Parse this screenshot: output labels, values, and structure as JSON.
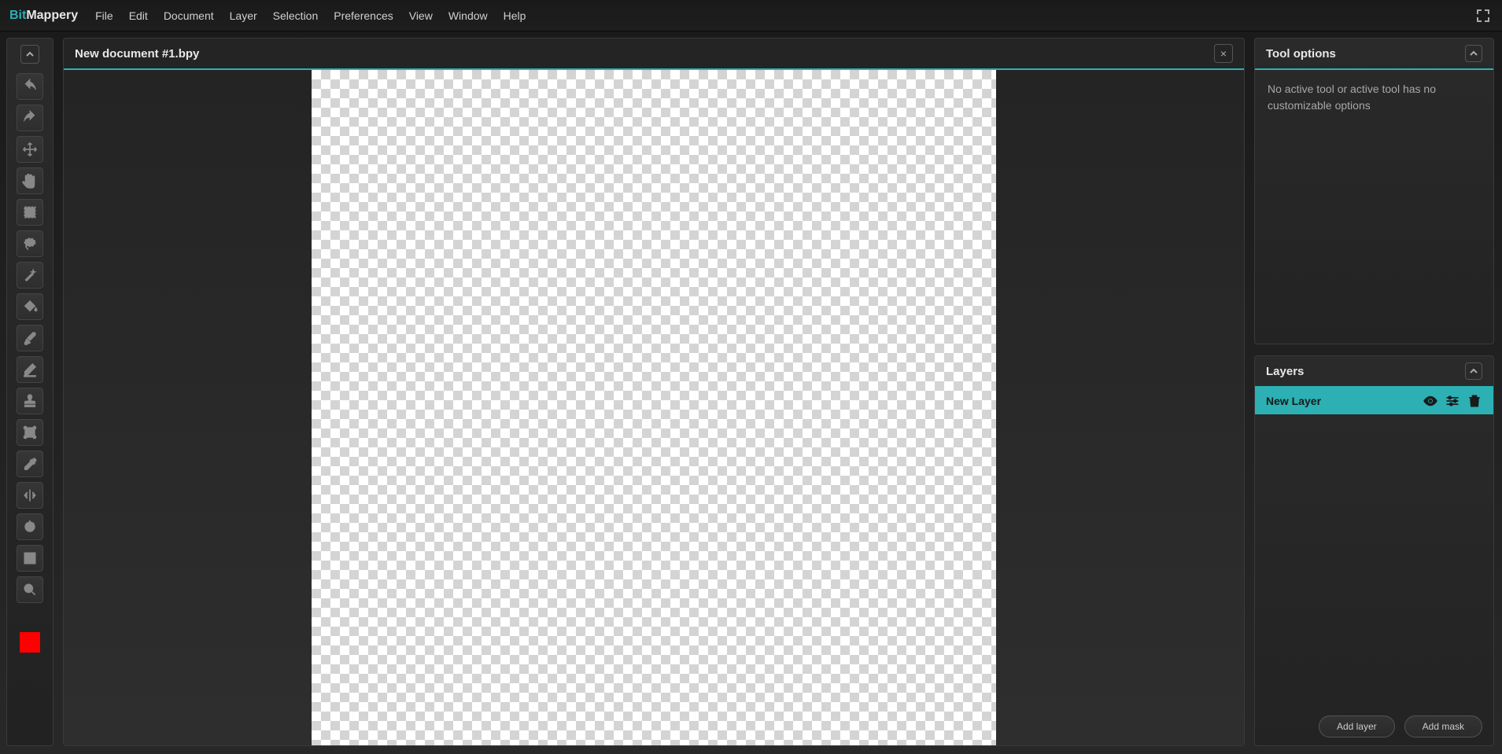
{
  "app": {
    "logo_bit": "Bit",
    "logo_mappery": "Mappery"
  },
  "menu": {
    "file": "File",
    "edit": "Edit",
    "document": "Document",
    "layer": "Layer",
    "selection": "Selection",
    "preferences": "Preferences",
    "view": "View",
    "window": "Window",
    "help": "Help"
  },
  "document": {
    "title": "New document #1.bpy"
  },
  "panels": {
    "tool_options": {
      "title": "Tool options",
      "message": "No active tool or active tool has no customizable options"
    },
    "layers": {
      "title": "Layers",
      "items": [
        {
          "name": "New Layer"
        }
      ],
      "add_layer_label": "Add layer",
      "add_mask_label": "Add mask"
    }
  },
  "colors": {
    "foreground": "#ff0000"
  }
}
